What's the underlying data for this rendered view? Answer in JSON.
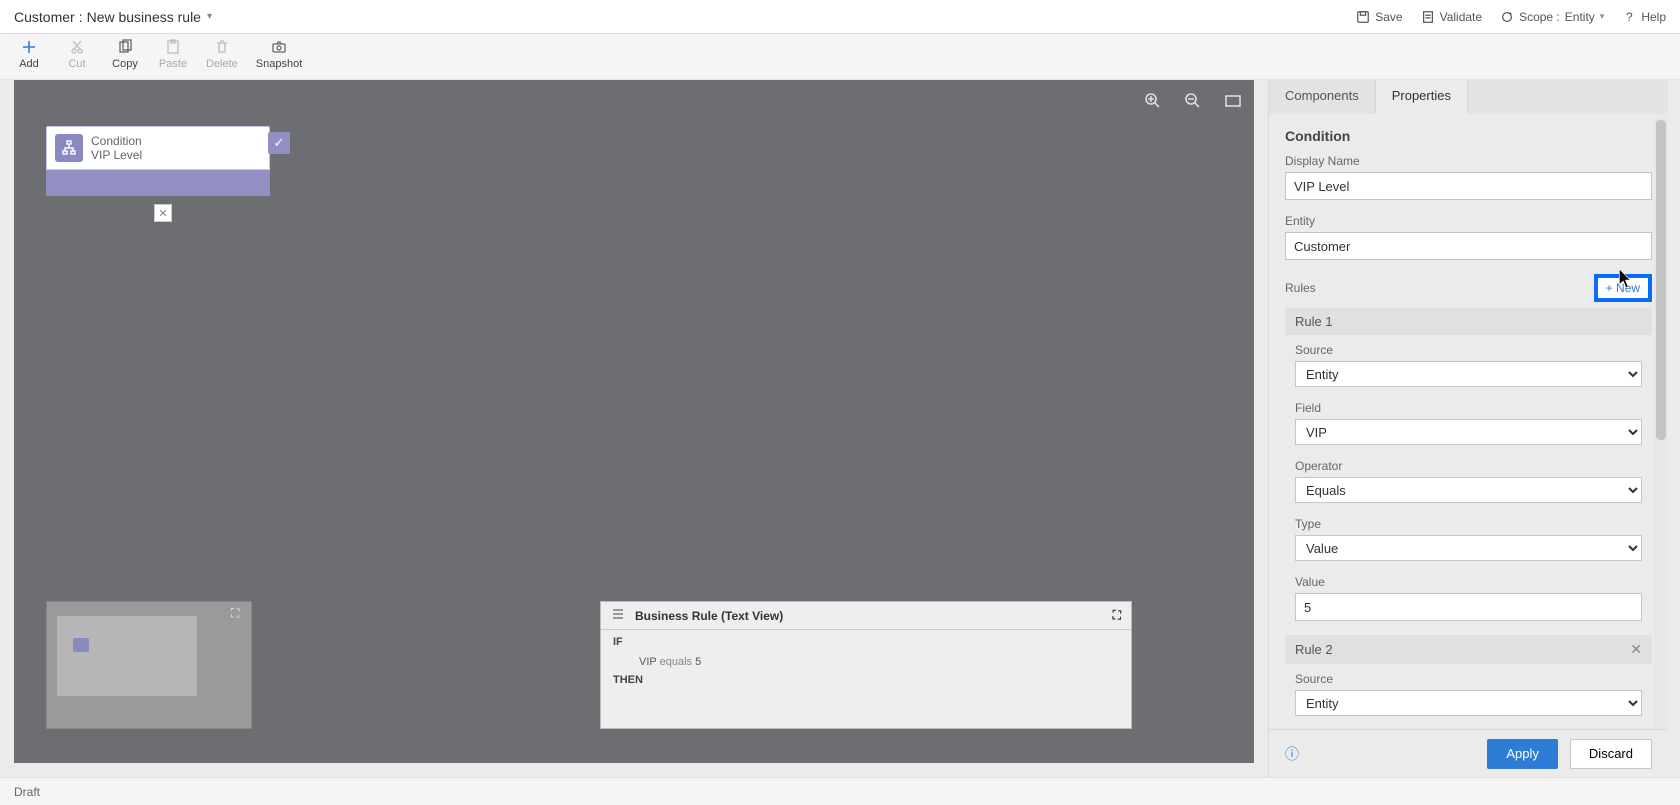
{
  "header": {
    "entity": "Customer",
    "separator": ":",
    "title": "New business rule",
    "save": "Save",
    "validate": "Validate",
    "scope_label": "Scope :",
    "scope_value": "Entity",
    "help": "Help"
  },
  "toolbar": {
    "add": "Add",
    "cut": "Cut",
    "copy": "Copy",
    "paste": "Paste",
    "delete": "Delete",
    "snapshot": "Snapshot"
  },
  "node": {
    "label": "Condition",
    "value": "VIP Level"
  },
  "textview": {
    "title": "Business Rule (Text View)",
    "if": "IF",
    "then": "THEN",
    "expr_field": "VIP",
    "expr_op": "equals",
    "expr_val": "5"
  },
  "panel": {
    "tab_components": "Components",
    "tab_properties": "Properties",
    "section": "Condition",
    "display_name_label": "Display Name",
    "display_name_value": "VIP Level",
    "entity_label": "Entity",
    "entity_value": "Customer",
    "rules_label": "Rules",
    "new_btn": "+ New",
    "rule1": "Rule 1",
    "rule2": "Rule 2",
    "source_label": "Source",
    "source_value": "Entity",
    "field_label": "Field",
    "field_value": "VIP",
    "operator_label": "Operator",
    "operator_value": "Equals",
    "type_label": "Type",
    "type_value": "Value",
    "value_label": "Value",
    "value_value": "5",
    "apply": "Apply",
    "discard": "Discard"
  },
  "status": {
    "draft": "Draft"
  }
}
